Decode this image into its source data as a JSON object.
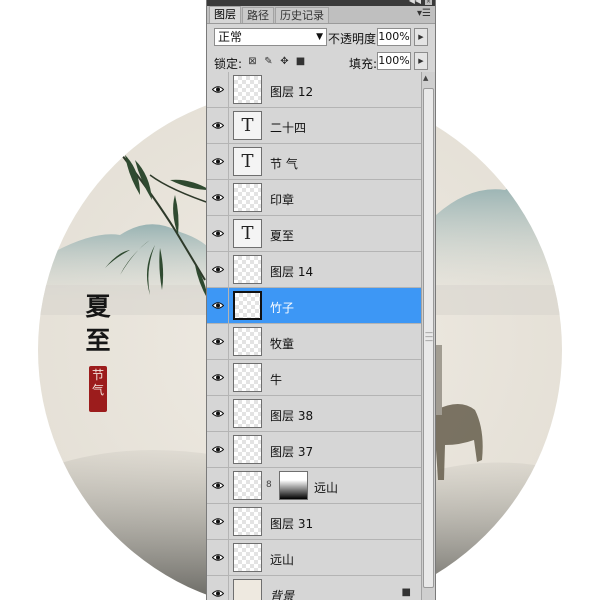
{
  "artwork": {
    "title": "夏至",
    "seal_text": "节气"
  },
  "panel": {
    "tabs": [
      {
        "label": "图层",
        "active": true
      },
      {
        "label": "路径",
        "active": false
      },
      {
        "label": "历史记录",
        "active": false
      }
    ],
    "menu_icon": "panel-menu-icon",
    "blend_mode": "正常",
    "opacity_label": "不透明度:",
    "opacity_value": "100%",
    "lock_label": "锁定:",
    "fill_label": "填充:",
    "fill_value": "100%",
    "layers": [
      {
        "name": "图层 12",
        "kind": "pixel"
      },
      {
        "name": "二十四",
        "kind": "text"
      },
      {
        "name": "节 气",
        "kind": "text"
      },
      {
        "name": "印章",
        "kind": "pixel"
      },
      {
        "name": "夏至",
        "kind": "text"
      },
      {
        "name": "图层 14",
        "kind": "pixel"
      },
      {
        "name": "竹子",
        "kind": "pixel",
        "selected": true
      },
      {
        "name": "牧童",
        "kind": "pixel"
      },
      {
        "name": "牛",
        "kind": "pixel"
      },
      {
        "name": "图层 38",
        "kind": "pixel"
      },
      {
        "name": "图层 37",
        "kind": "pixel"
      },
      {
        "name": "远山",
        "kind": "masked"
      },
      {
        "name": "图层 31",
        "kind": "pixel"
      },
      {
        "name": "远山",
        "kind": "pixel"
      },
      {
        "name": "背景",
        "kind": "background",
        "locked": true
      }
    ],
    "text_thumb_glyph": "T",
    "colors": {
      "selected_row": "#3d97f5",
      "panel_bg": "#d6d6d6",
      "seal_red": "#9c1c1c"
    }
  }
}
